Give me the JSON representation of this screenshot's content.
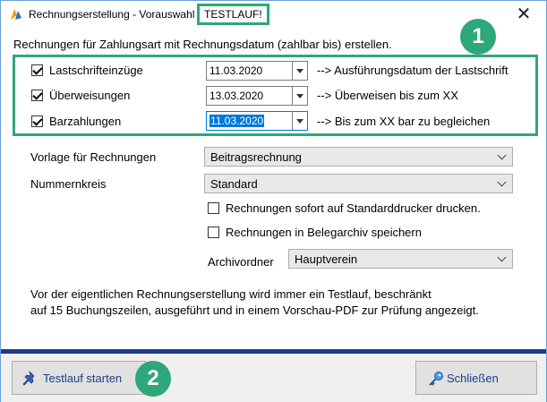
{
  "window": {
    "title": "Rechnungserstellung - Vorauswahl",
    "badge": "TESTLAUF!",
    "close_glyph": "✕"
  },
  "heading": "Rechnungen für Zahlungsart mit Rechnungsdatum (zahlbar bis) erstellen.",
  "markers": {
    "one": "1",
    "two": "2"
  },
  "payment_types": [
    {
      "label": "Lastschrifteinzüge",
      "checked": true,
      "date": "11.03.2020",
      "hint": "--> Ausführungsdatum der Lastschrift"
    },
    {
      "label": "Überweisungen",
      "checked": true,
      "date": "13.03.2020",
      "hint": "--> Überweisen bis zum XX"
    },
    {
      "label": "Barzahlungen",
      "checked": true,
      "date": "11.03.2020",
      "hint": "--> Bis zum XX bar zu begleichen"
    }
  ],
  "template": {
    "label": "Vorlage für Rechnungen",
    "value": "Beitragsrechnung"
  },
  "number_range": {
    "label": "Nummernkreis",
    "value": "Standard"
  },
  "options": {
    "print_label": "Rechnungen sofort auf Standarddrucker drucken.",
    "archive_label": "Rechnungen in Belegarchiv speichern"
  },
  "archive_folder": {
    "label": "Archivordner",
    "value": "Hauptverein"
  },
  "info": {
    "line1": "Vor der eigentlichen Rechnungserstellung wird immer ein Testlauf, beschränkt",
    "line2": "auf 15 Buchungszeilen, ausgeführt und in einem Vorschau-PDF zur Prüfung angezeigt."
  },
  "buttons": {
    "run": "Testlauf starten",
    "close": "Schließen"
  },
  "colors": {
    "accent": "#2ea77a",
    "separator": "#1f3a8a",
    "button_text": "#1a3f8a"
  },
  "icons": {
    "app": "app-logo-icon",
    "run": "pushpin-icon",
    "close": "key-icon"
  }
}
